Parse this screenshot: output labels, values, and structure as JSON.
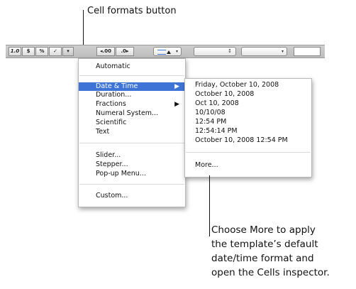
{
  "callouts": {
    "top": "Cell formats button",
    "bottom_lines": [
      "Choose More to apply",
      "the template’s default",
      "date/time format and",
      "open the Cells inspector."
    ]
  },
  "toolbar": {
    "buttons": [
      "1.0",
      "$",
      "%",
      "✓",
      "▾",
      "◂.00",
      ".0▸"
    ],
    "dropdown_arrow": "▾",
    "stepper_arrow": "↕"
  },
  "menu": {
    "items": [
      "Automatic",
      "Date & Time",
      "Duration...",
      "Fractions",
      "Numeral System...",
      "Scientific",
      "Text",
      "Slider...",
      "Stepper...",
      "Pop-up Menu...",
      "Custom..."
    ],
    "submenu_arrow": "▶"
  },
  "submenu": {
    "items": [
      "Friday, October 10, 2008",
      "October 10, 2008",
      "Oct 10, 2008",
      "10/10/08",
      "12:54 PM",
      "12:54:14 PM",
      "October 10, 2008 12:54 PM",
      "More..."
    ]
  },
  "colors": {
    "highlight": "#3f74d7",
    "toolbar": "#c6c6c6"
  }
}
